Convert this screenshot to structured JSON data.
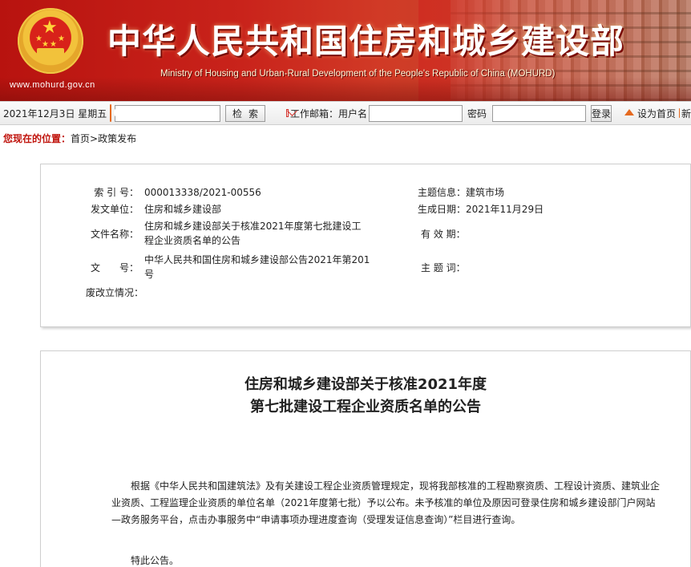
{
  "header": {
    "title": "中华人民共和国住房和城乡建设部",
    "subtitle": "Ministry of Housing and Urban-Rural Development of the People's Republic of China (MOHURD)",
    "url": "www.mohurd.gov.cn"
  },
  "toolbar": {
    "date": "2021年12月3日 星期五",
    "search_value": "",
    "search_button": "检索",
    "mail_label": "工作邮箱：",
    "username_label": "用户名",
    "password_label": "密码",
    "login_button": "登录",
    "home_link": "设为首页",
    "rss_link": "新"
  },
  "breadcrumb": {
    "label": "您现在的位置：",
    "items": [
      "首页",
      "政策发布"
    ],
    "separator": ">"
  },
  "metadata": {
    "index_label": "索 引 号：",
    "index_value": "000013338/2021-00556",
    "issuer_label": "发文单位：",
    "issuer_value": "住房和城乡建设部",
    "filename_label": "文件名称：",
    "filename_value": "住房和城乡建设部关于核准2021年度第七批建设工程企业资质名单的公告",
    "docno_label": "文　　号：",
    "docno_value": "中华人民共和国住房和城乡建设部公告2021年第201号",
    "status_label": "废改立情况：",
    "status_value": "",
    "topic_label": "主题信息：",
    "topic_value": "建筑市场",
    "date_label": "生成日期：",
    "date_value": "2021年11月29日",
    "validity_label": "有 效 期：",
    "validity_value": "",
    "keywords_label": "主 题 词：",
    "keywords_value": ""
  },
  "article": {
    "title_line1": "住房和城乡建设部关于核准2021年度",
    "title_line2": "第七批建设工程企业资质名单的公告",
    "paragraph1": "根据《中华人民共和国建筑法》及有关建设工程企业资质管理规定，现将我部核准的工程勘察资质、工程设计资质、建筑业企业资质、工程监理企业资质的单位名单（2021年度第七批）予以公布。未予核准的单位及原因可登录住房和城乡建设部门户网站—政务服务平台，点击办事服务中“申请事项办理进度查询（受理发证信息查询）”栏目进行查询。",
    "paragraph2": "特此公告。"
  },
  "colors": {
    "brand_red": "#c0140d",
    "accent_orange": "#e56a20"
  }
}
